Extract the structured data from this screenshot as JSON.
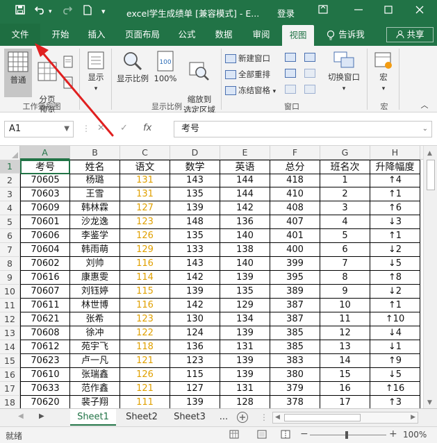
{
  "titlebar": {
    "title": "excel学生成绩单  [兼容模式]  -  E...",
    "login": "登录",
    "save_icon": "save-icon",
    "undo_icon": "undo-icon",
    "redo_icon": "redo-icon",
    "new_icon": "new-file-icon"
  },
  "tabs": [
    {
      "label": "文件"
    },
    {
      "label": "开始"
    },
    {
      "label": "插入"
    },
    {
      "label": "页面布局"
    },
    {
      "label": "公式"
    },
    {
      "label": "数据"
    },
    {
      "label": "审阅"
    },
    {
      "label": "视图"
    },
    {
      "label": "告诉我"
    },
    {
      "label": "共享"
    }
  ],
  "ribbon": {
    "normal": "普通",
    "pagebreak": "分页\n预览",
    "show": "显示",
    "zoom": "显示比例",
    "zoom100": "100%",
    "zoom_sel": "缩放到\n选定区域",
    "new_window": "新建窗口",
    "arrange_all": "全部重排",
    "freeze": "冻结窗格",
    "switch_window": "切换窗口",
    "macro": "宏",
    "group_workbook_views": "工作簿视图",
    "group_zoom": "显示比例",
    "group_window": "窗口",
    "group_macro": "宏"
  },
  "formula_bar": {
    "name_box": "A1",
    "content": "考号",
    "cancel": "✕",
    "enter": "✓",
    "fx": "fx"
  },
  "columns": [
    "A",
    "B",
    "C",
    "D",
    "E",
    "F",
    "G",
    "H"
  ],
  "table": {
    "headers": [
      "考号",
      "姓名",
      "语文",
      "数学",
      "英语",
      "总分",
      "班名次",
      "升降幅度"
    ],
    "rows": [
      [
        "70605",
        "杨璐",
        "131",
        "143",
        "144",
        "418",
        "1",
        "↑4"
      ],
      [
        "70603",
        "王雪",
        "131",
        "135",
        "144",
        "410",
        "2",
        "↑1"
      ],
      [
        "70609",
        "韩林霖",
        "127",
        "139",
        "142",
        "408",
        "3",
        "↑6"
      ],
      [
        "70601",
        "沙龙逸",
        "123",
        "148",
        "136",
        "407",
        "4",
        "↓3"
      ],
      [
        "70606",
        "李鉴学",
        "126",
        "135",
        "140",
        "401",
        "5",
        "↑1"
      ],
      [
        "70604",
        "韩雨萌",
        "129",
        "133",
        "138",
        "400",
        "6",
        "↓2"
      ],
      [
        "70602",
        "刘帅",
        "116",
        "143",
        "140",
        "399",
        "7",
        "↓5"
      ],
      [
        "70616",
        "康惠雯",
        "114",
        "142",
        "139",
        "395",
        "8",
        "↑8"
      ],
      [
        "70607",
        "刘钰婷",
        "115",
        "139",
        "135",
        "389",
        "9",
        "↓2"
      ],
      [
        "70611",
        "林世博",
        "116",
        "142",
        "129",
        "387",
        "10",
        "↑1"
      ],
      [
        "70621",
        "张希",
        "123",
        "130",
        "134",
        "387",
        "11",
        "↑10"
      ],
      [
        "70608",
        "徐冲",
        "122",
        "124",
        "139",
        "385",
        "12",
        "↓4"
      ],
      [
        "70612",
        "苑宇飞",
        "118",
        "136",
        "131",
        "385",
        "13",
        "↓1"
      ],
      [
        "70623",
        "卢一凡",
        "121",
        "123",
        "139",
        "383",
        "14",
        "↑9"
      ],
      [
        "70610",
        "张瑞鑫",
        "126",
        "115",
        "139",
        "380",
        "15",
        "↓5"
      ],
      [
        "70633",
        "范作鑫",
        "121",
        "127",
        "131",
        "379",
        "16",
        "↑16"
      ],
      [
        "70620",
        "裴子翔",
        "111",
        "139",
        "128",
        "378",
        "17",
        "↑3"
      ]
    ]
  },
  "row_numbers": [
    "1",
    "2",
    "3",
    "4",
    "5",
    "6",
    "7",
    "8",
    "9",
    "10",
    "11",
    "12",
    "13",
    "14",
    "15",
    "16",
    "17",
    "18"
  ],
  "sheets": [
    "Sheet1",
    "Sheet2",
    "Sheet3",
    "..."
  ],
  "status": {
    "ready": "就绪",
    "zoom": "100%"
  },
  "colors": {
    "accent": "#217346",
    "orange_score": "#e0a000",
    "arrow": "#e02020"
  }
}
